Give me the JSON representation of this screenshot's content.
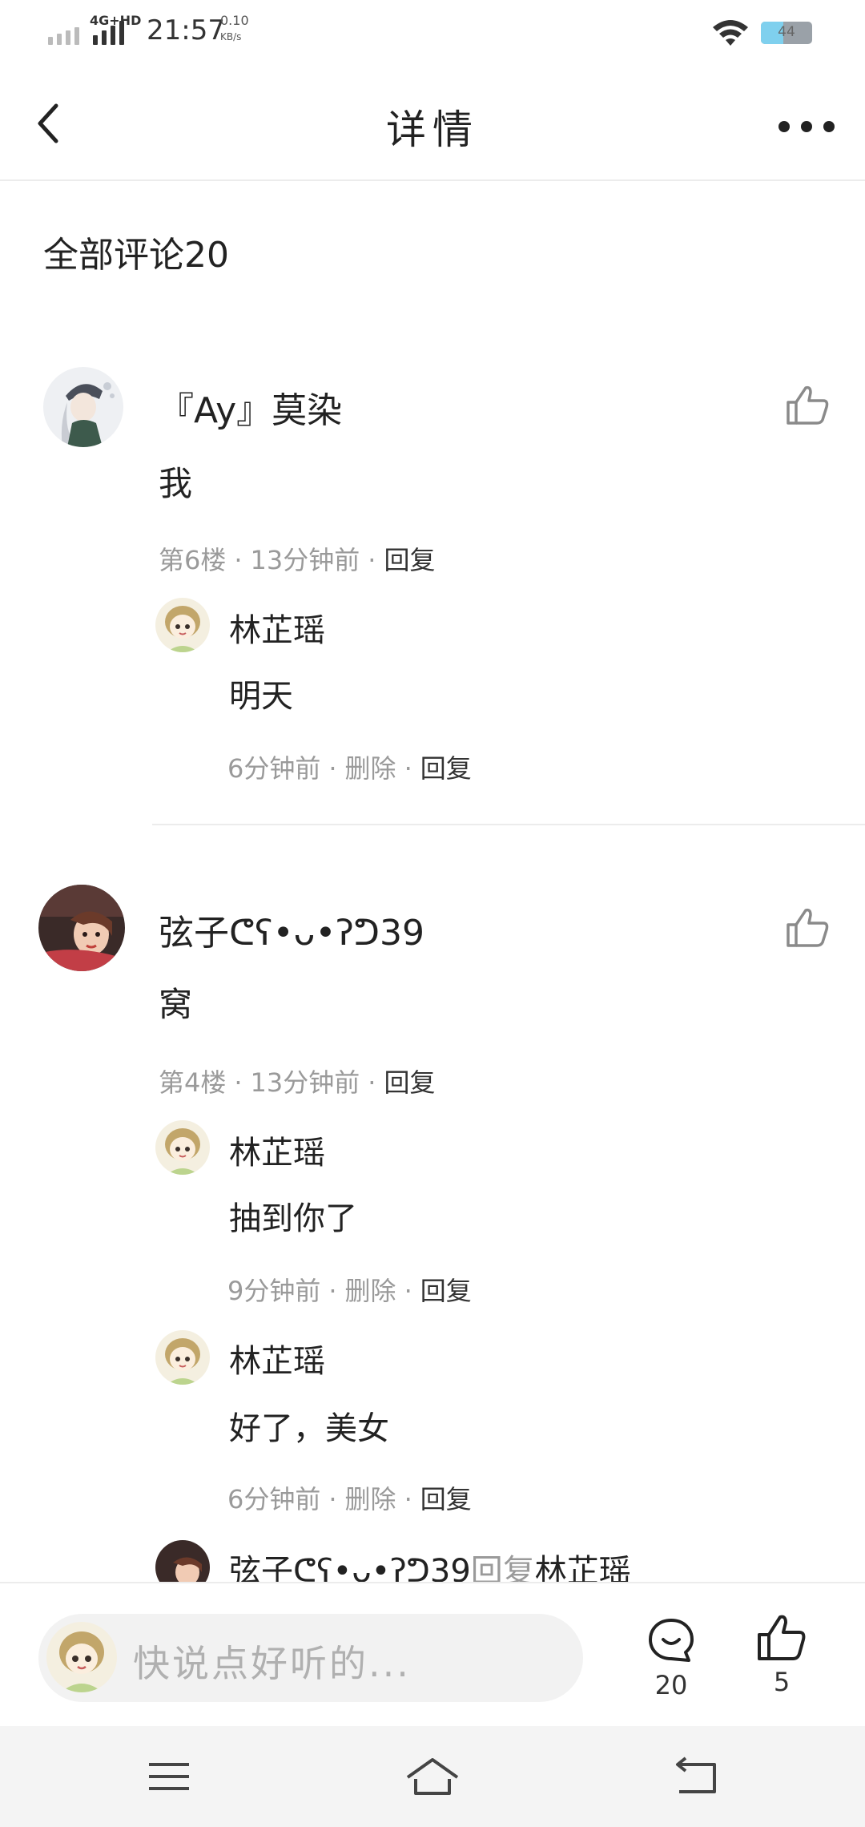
{
  "status": {
    "network": "4G+HD",
    "time": "21:57",
    "speed": "0.10",
    "speed_unit": "KB/s",
    "battery_level": "44",
    "battery_fraction": 0.44
  },
  "header": {
    "title": "详情"
  },
  "section_title": "全部评论20",
  "comments": [
    {
      "username": "『Ay』莫染",
      "content": "我",
      "floor": "第6楼",
      "time": "13分钟前",
      "reply_label": "回复",
      "replies": [
        {
          "username": "林芷瑶",
          "content": "明天",
          "time": "6分钟前",
          "delete_label": "删除",
          "reply_label": "回复"
        }
      ]
    },
    {
      "username": "弦子ᕦʕ•ᴗ•ʔᕤ39",
      "content": "窝",
      "floor": "第4楼",
      "time": "13分钟前",
      "reply_label": "回复",
      "replies": [
        {
          "username": "林芷瑶",
          "content": "抽到你了",
          "time": "9分钟前",
          "delete_label": "删除",
          "reply_label": "回复"
        },
        {
          "username": "林芷瑶",
          "content": "好了，美女",
          "time": "6分钟前",
          "delete_label": "删除",
          "reply_label": "回复"
        },
        {
          "username": "弦子ᕦʕ•ᴗ•ʔᕤ39",
          "reply_word": "回复",
          "target": "林芷瑶"
        }
      ]
    }
  ],
  "bottom_bar": {
    "placeholder": "快说点好听的...",
    "comment_count": "20",
    "like_count": "5"
  },
  "colors": {
    "muted": "#9a9a9a",
    "text": "#222222",
    "divider": "#ececec",
    "battery_fill": "#7fd0ee"
  },
  "icons": [
    "back-icon",
    "more-icon",
    "thumb-up-icon",
    "comment-bubble-icon",
    "menu-icon",
    "home-icon",
    "back-nav-icon",
    "wifi-icon",
    "battery-icon"
  ]
}
